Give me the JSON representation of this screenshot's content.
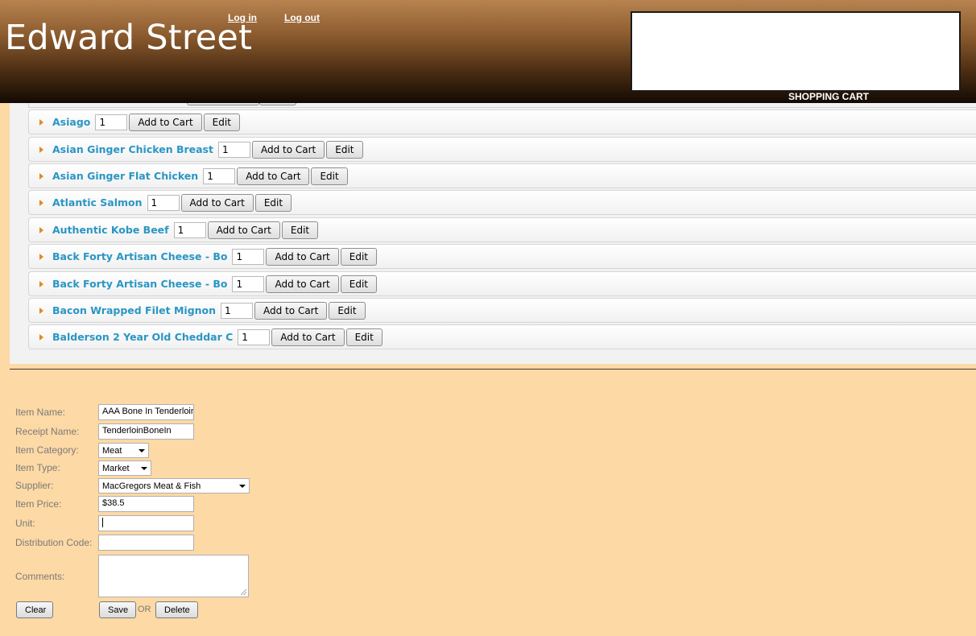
{
  "header": {
    "site_title": "Edward Street",
    "login_label": "Log in",
    "logout_label": "Log out",
    "cart_label": "SHOPPING CART"
  },
  "products": {
    "add_label": "Add to Cart",
    "edit_label": "Edit",
    "items": [
      {
        "name": "Asiago",
        "qty": "1"
      },
      {
        "name": "Asian Ginger Chicken Breast",
        "qty": "1"
      },
      {
        "name": "Asian Ginger Flat Chicken",
        "qty": "1"
      },
      {
        "name": "Atlantic Salmon",
        "qty": "1"
      },
      {
        "name": "Authentic Kobe Beef",
        "qty": "1"
      },
      {
        "name": "Back Forty Artisan Cheese - Bo",
        "qty": "1"
      },
      {
        "name": "Back Forty Artisan Cheese - Bo",
        "qty": "1"
      },
      {
        "name": "Bacon Wrapped Filet Mignon",
        "qty": "1"
      },
      {
        "name": "Balderson 2 Year Old Cheddar C",
        "qty": "1"
      }
    ]
  },
  "form": {
    "item_name_label": "Item Name:",
    "item_name_value": "AAA Bone In Tenderloin",
    "receipt_name_label": "Receipt Name:",
    "receipt_name_value": "TenderloinBoneIn",
    "item_category_label": "Item Category:",
    "item_category_value": "Meat",
    "item_type_label": "Item Type:",
    "item_type_value": "Market",
    "supplier_label": "Supplier:",
    "supplier_value": "MacGregors Meat & Fish",
    "item_price_label": "Item Price:",
    "item_price_value": "$38.5",
    "unit_label": "Unit:",
    "unit_value": "",
    "distribution_code_label": "Distribution Code:",
    "distribution_code_value": "",
    "comments_label": "Comments:",
    "clear_label": "Clear",
    "save_label": "Save",
    "or_label": "OR",
    "delete_label": "Delete"
  }
}
